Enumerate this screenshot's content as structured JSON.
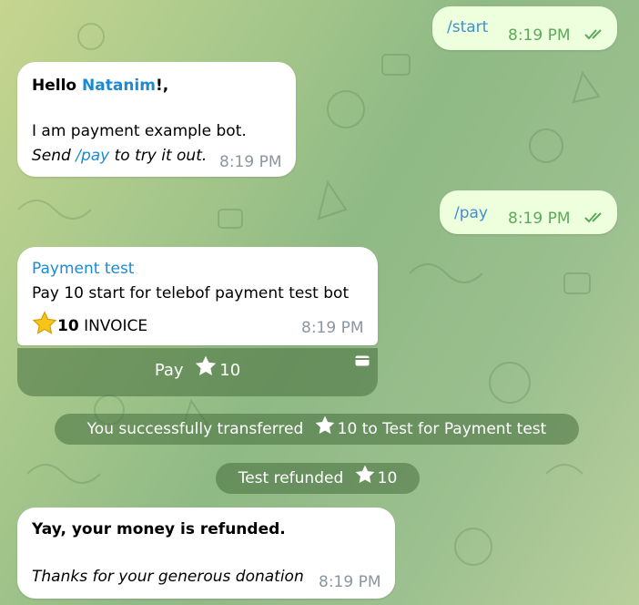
{
  "messages": {
    "m1": {
      "text": "/start",
      "time": "8:19 PM"
    },
    "m2": {
      "greeting_prefix": "Hello ",
      "name": "Natanim",
      "greeting_suffix": "!,",
      "line2": "I am payment example bot.",
      "line3_prefix": "Send ",
      "line3_cmd": "/pay",
      "line3_suffix": " to try it out.",
      "time": "8:19 PM"
    },
    "m3": {
      "text": "/pay",
      "time": "8:19 PM"
    },
    "invoice": {
      "title": "Payment test",
      "description": "Pay 10 start for telebof payment test bot",
      "amount": "10",
      "label": " INVOICE",
      "time": "8:19 PM"
    },
    "pay_button": {
      "label_prefix": "Pay",
      "amount": "10"
    },
    "service1": {
      "prefix": "You successfully transferred",
      "amount": "10 to Test for Payment test"
    },
    "service2": {
      "prefix": "Test refunded",
      "amount": "10"
    },
    "m5": {
      "line1": "Yay, your money is refunded.",
      "line2": "Thanks for your generous donation",
      "time": "8:19 PM"
    }
  },
  "colors": {
    "link": "#1a8ad5",
    "outgoing_bubble": "#eeffde",
    "incoming_bubble": "#ffffff",
    "service_bg": "#5b8a4e"
  }
}
